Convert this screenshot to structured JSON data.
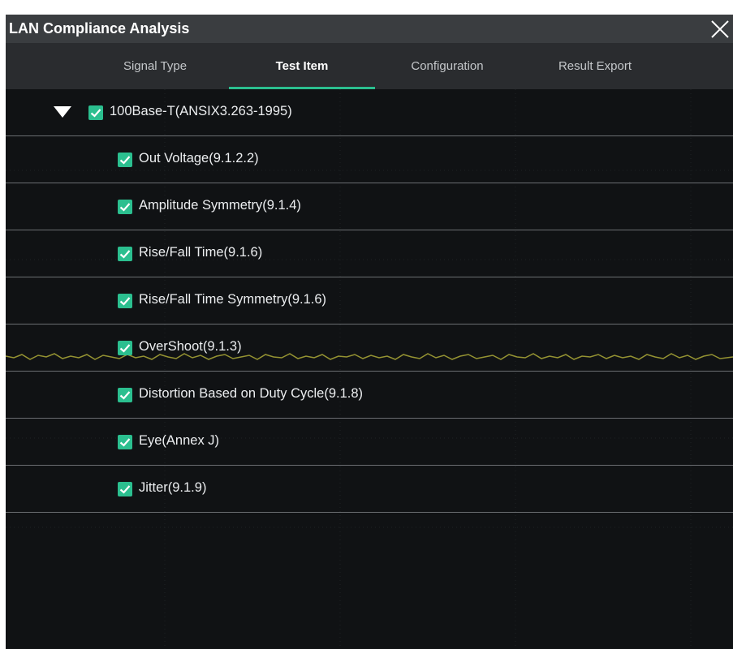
{
  "window": {
    "title": "LAN Compliance Analysis",
    "close_icon": "close-icon"
  },
  "tabs": [
    {
      "label": "Signal Type",
      "active": false
    },
    {
      "label": "Test Item",
      "active": true
    },
    {
      "label": "Configuration",
      "active": false
    },
    {
      "label": "Result Export",
      "active": false
    }
  ],
  "tree": {
    "root": {
      "label": "100Base-T(ANSIX3.263-1995)",
      "checked": true,
      "expanded": true,
      "expand_icon": "triangle-down-icon"
    },
    "items": [
      {
        "label": "Out Voltage(9.1.2.2)",
        "checked": true
      },
      {
        "label": "Amplitude Symmetry(9.1.4)",
        "checked": true
      },
      {
        "label": "Rise/Fall Time(9.1.6)",
        "checked": true
      },
      {
        "label": "Rise/Fall Time Symmetry(9.1.6)",
        "checked": true
      },
      {
        "label": "OverShoot(9.1.3)",
        "checked": true
      },
      {
        "label": "Distortion Based on Duty Cycle(9.1.8)",
        "checked": true
      },
      {
        "label": "Eye(Annex J)",
        "checked": true
      },
      {
        "label": "Jitter(9.1.9)",
        "checked": true
      }
    ]
  },
  "colors": {
    "accent": "#2bbf8f",
    "background": "#101214",
    "titlebar": "#3a3d40",
    "tabbar": "#2a2c2f",
    "waveform": "#b7b43a"
  }
}
